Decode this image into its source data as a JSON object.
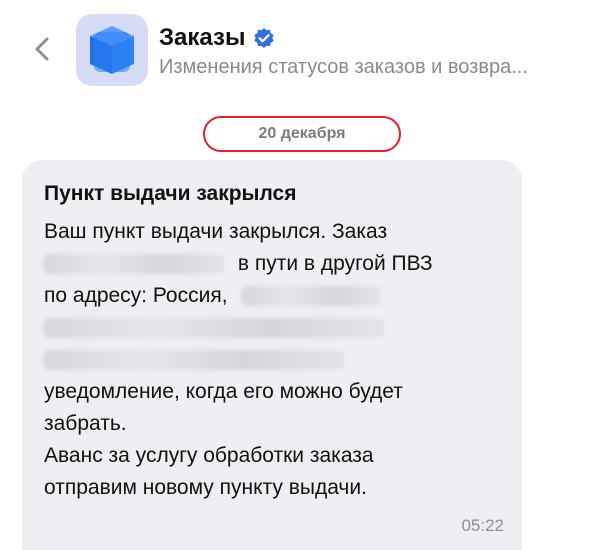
{
  "header": {
    "title": "Заказы",
    "subtitle": "Изменения статусов заказов и возвра...",
    "back_icon": "chevron-left-icon",
    "app_icon": "package-cube-icon",
    "verified_icon": "verified-check-icon",
    "accent_color": "#2f6fe4",
    "icon_bg_color": "#d6dcf5"
  },
  "date_separator": {
    "label": "20 декабря",
    "highlight_color": "#e3202b"
  },
  "message": {
    "title": "Пункт выдачи закрылся",
    "line1": "Ваш пункт выдачи закрылся. Заказ",
    "line2_suffix": "в пути в другой ПВЗ",
    "line3_prefix": "по адресу: Россия,",
    "line6": "уведомление, когда его можно будет",
    "line7": "забрать.",
    "line8": "Аванс за услугу обработки заказа",
    "line9": "отправим новому пункту выдачи.",
    "time": "05:22",
    "bubble_color": "#efeff3"
  }
}
